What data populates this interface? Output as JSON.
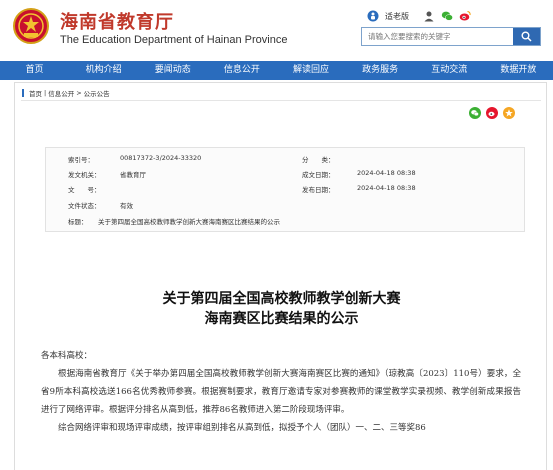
{
  "header": {
    "title_cn": "海南省教育厅",
    "title_en": "The Education Department of Hainan Province",
    "top_links": {
      "accessibility": "适老版"
    },
    "search": {
      "placeholder": "请输入您要搜索的关键字"
    }
  },
  "nav": {
    "items": [
      "首页",
      "机构介绍",
      "要闻动态",
      "信息公开",
      "解读回应",
      "政务服务",
      "互动交流",
      "数据开放"
    ]
  },
  "breadcrumb": [
    "首页",
    "信息公开",
    "公示公告"
  ],
  "info": {
    "index_label": "索引号：",
    "index_value": "00817372-3/2024-33320",
    "category_label": "分　　类：",
    "category_value": "",
    "issuer_label": "发文机关：",
    "issuer_value": "省教育厅",
    "created_label": "成文日期：",
    "created_value": "2024-04-18 08:38",
    "docno_label": "文　　号：",
    "docno_value": "",
    "published_label": "发布日期：",
    "published_value": "2024-04-18 08:38",
    "validity_label": "文件状态：",
    "validity_value": "有效",
    "subject_label": "标题：",
    "subject_value": "关于第四届全国高校教师教学创新大赛海南赛区比赛结果的公示"
  },
  "doc": {
    "title_line1": "关于第四届全国高校教师教学创新大赛",
    "title_line2": "海南赛区比赛结果的公示",
    "salutation": "各本科高校：",
    "para1": "根据海南省教育厅《关于举办第四届全国高校教师教学创新大赛海南赛区比赛的通知》（琼教高〔2023〕110号）要求，全省9所本科高校选送166名优秀教师参赛。根据赛制要求，教育厅邀请专家对参赛教师的课堂教学实录视频、教学创新成果报告进行了网络评审。根据评分排名从高到低，推荐86名教师进入第二阶段现场评审。",
    "para2": "综合网络评审和现场评审成绩，按评审组别排名从高到低，拟授予个人（团队）一、二、三等奖86"
  },
  "colors": {
    "brand_red": "#c0392b",
    "nav_blue": "#2a6cbd"
  },
  "icons": {
    "emblem": "national-emblem-icon",
    "accessibility": "person-icon",
    "weibo": "weibo-icon",
    "wechat": "wechat-icon",
    "search": "search-icon"
  }
}
